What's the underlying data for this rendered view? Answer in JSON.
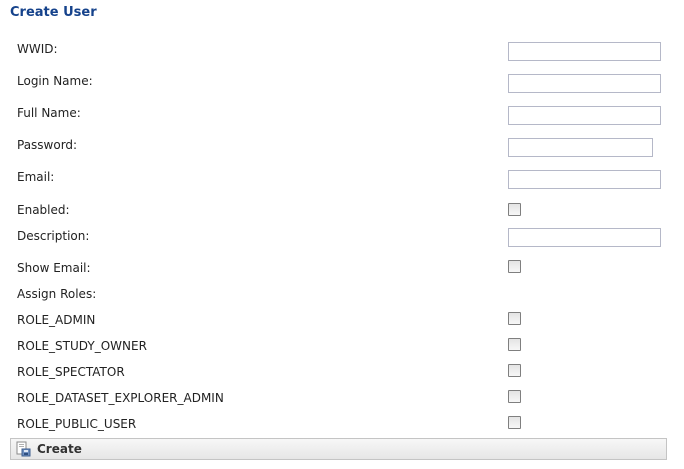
{
  "header": {
    "title": "Create User"
  },
  "form": {
    "wwid_label": "WWID:",
    "login_label": "Login Name:",
    "fullname_label": "Full Name:",
    "password_label": "Password:",
    "email_label": "Email:",
    "enabled_label": "Enabled:",
    "description_label": "Description:",
    "show_email_label": "Show Email:",
    "assign_roles_label": "Assign Roles:",
    "wwid_value": "",
    "login_value": "",
    "fullname_value": "",
    "password_value": "",
    "email_value": "",
    "description_value": "",
    "enabled_checked": false,
    "show_email_checked": false
  },
  "roles": [
    {
      "label": "ROLE_ADMIN",
      "checked": false
    },
    {
      "label": "ROLE_STUDY_OWNER",
      "checked": false
    },
    {
      "label": "ROLE_SPECTATOR",
      "checked": false
    },
    {
      "label": "ROLE_DATASET_EXPLORER_ADMIN",
      "checked": false
    },
    {
      "label": "ROLE_PUBLIC_USER",
      "checked": false
    }
  ],
  "toolbar": {
    "create_label": "Create",
    "create_icon": "save-icon"
  },
  "colors": {
    "title": "#15428b",
    "input_border": "#b5b8c8",
    "toolbar_bg": "#ececec"
  }
}
